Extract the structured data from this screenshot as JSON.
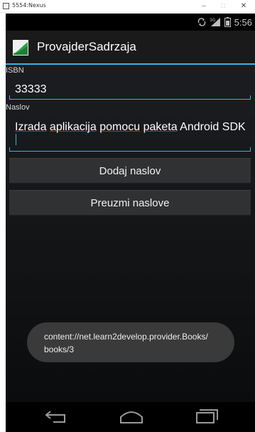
{
  "window": {
    "title": "5554:Nexus",
    "minimize_glyph": "–",
    "maximize_glyph": "□",
    "close_glyph": "✕"
  },
  "status_bar": {
    "time": "5:56",
    "icons": [
      "sync-icon",
      "signal-3g-icon",
      "battery-icon"
    ]
  },
  "action_bar": {
    "app_title": "ProvajderSadrzaja",
    "accent_color": "#33b5e5"
  },
  "form": {
    "isbn_label": "ISBN",
    "isbn_value": "33333",
    "naslov_label": "Naslov",
    "naslov_value": {
      "word1": "Izrada",
      "word2": "aplikacija",
      "word3": "pomocu",
      "word4": "paketa",
      "rest": "Android SDK"
    }
  },
  "buttons": {
    "add_label": "Dodaj naslov",
    "get_label": "Preuzmi naslove"
  },
  "toast": {
    "line1": "content://net.learn2develop.provider.Books/",
    "line2": "books/3"
  },
  "nav_bar": {
    "icons": [
      "back-icon",
      "home-icon",
      "recent-apps-icon"
    ]
  }
}
